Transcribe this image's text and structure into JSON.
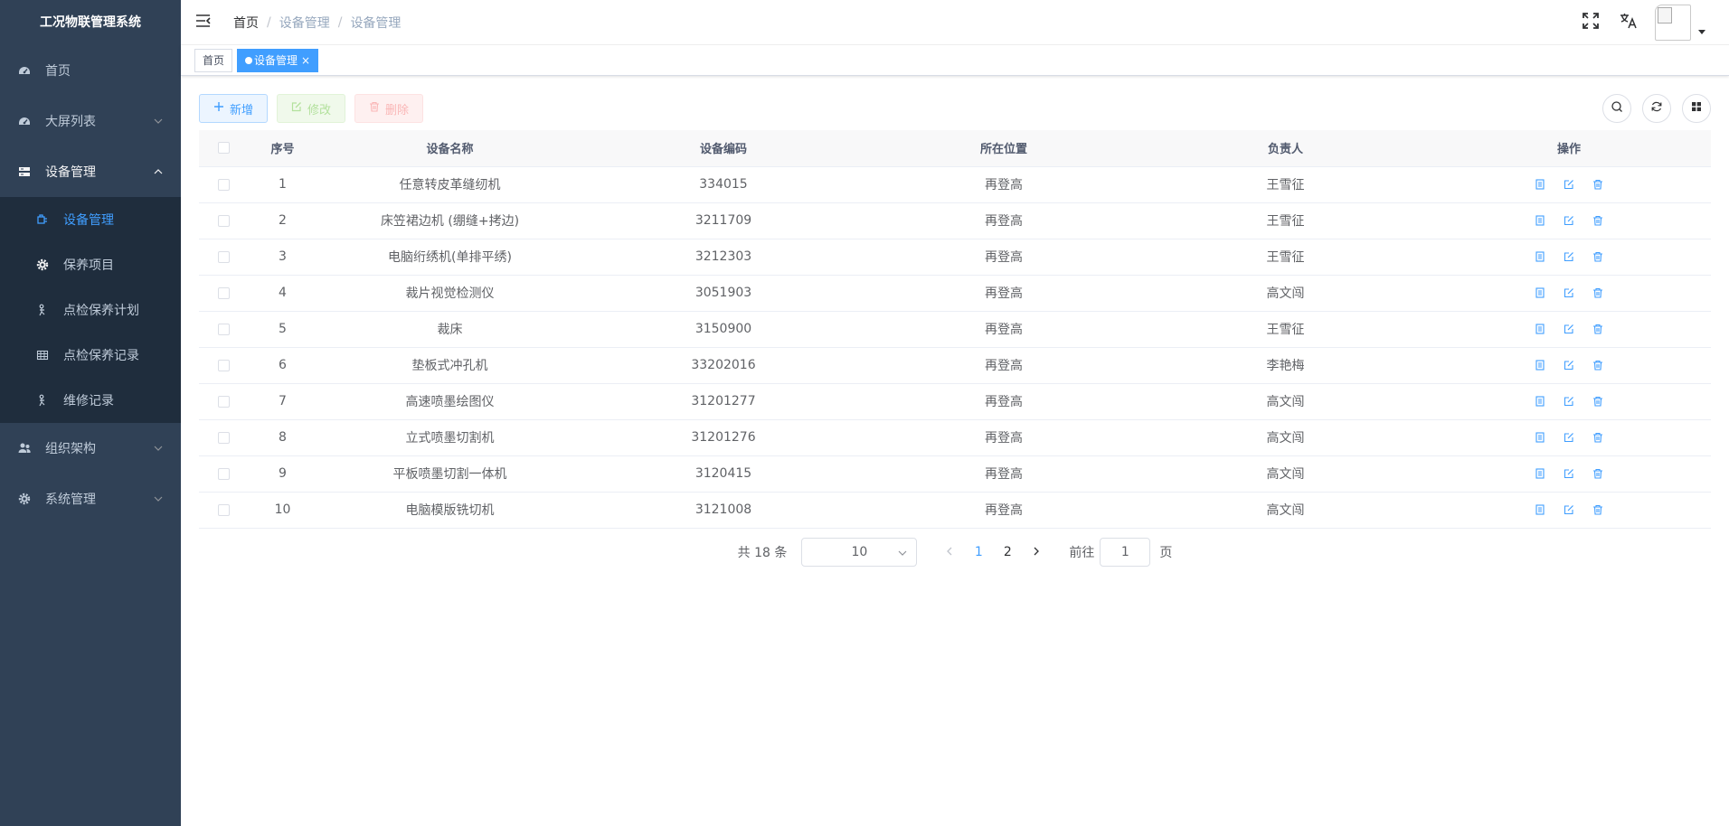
{
  "app": {
    "title": "工况物联管理系统"
  },
  "sidebar": {
    "items": [
      {
        "label": "首页"
      },
      {
        "label": "大屏列表"
      },
      {
        "label": "设备管理"
      },
      {
        "label": "组织架构"
      },
      {
        "label": "系统管理"
      }
    ],
    "submenu": [
      {
        "label": "设备管理"
      },
      {
        "label": "保养项目"
      },
      {
        "label": "点检保养计划"
      },
      {
        "label": "点检保养记录"
      },
      {
        "label": "维修记录"
      }
    ]
  },
  "breadcrumb": {
    "home": "首页",
    "level1": "设备管理",
    "level2": "设备管理",
    "sep": "/"
  },
  "tags": {
    "home": "首页",
    "active": "设备管理",
    "close": "×"
  },
  "toolbar": {
    "add": "新增",
    "edit": "修改",
    "delete": "删除"
  },
  "table": {
    "headers": {
      "index": "序号",
      "name": "设备名称",
      "code": "设备编码",
      "location": "所在位置",
      "owner": "负责人",
      "actions": "操作"
    },
    "rows": [
      {
        "index": "1",
        "name": "任意转皮革缝纫机",
        "code": "334015",
        "location": "再登高",
        "owner": "王雪征"
      },
      {
        "index": "2",
        "name": "床笠裙边机 (绷缝+拷边)",
        "code": "3211709",
        "location": "再登高",
        "owner": "王雪征"
      },
      {
        "index": "3",
        "name": "电脑绗绣机(单排平绣)",
        "code": "3212303",
        "location": "再登高",
        "owner": "王雪征"
      },
      {
        "index": "4",
        "name": "裁片视觉检测仪",
        "code": "3051903",
        "location": "再登高",
        "owner": "高文闯"
      },
      {
        "index": "5",
        "name": "裁床",
        "code": "3150900",
        "location": "再登高",
        "owner": "王雪征"
      },
      {
        "index": "6",
        "name": "垫板式冲孔机",
        "code": "33202016",
        "location": "再登高",
        "owner": "李艳梅"
      },
      {
        "index": "7",
        "name": "高速喷墨绘图仪",
        "code": "31201277",
        "location": "再登高",
        "owner": "高文闯"
      },
      {
        "index": "8",
        "name": "立式喷墨切割机",
        "code": "31201276",
        "location": "再登高",
        "owner": "高文闯"
      },
      {
        "index": "9",
        "name": "平板喷墨切割一体机",
        "code": "3120415",
        "location": "再登高",
        "owner": "高文闯"
      },
      {
        "index": "10",
        "name": "电脑模版铣切机",
        "code": "3121008",
        "location": "再登高",
        "owner": "高文闯"
      }
    ]
  },
  "pagination": {
    "total": "共 18 条",
    "page_size": "10",
    "pages": [
      "1",
      "2"
    ],
    "current": "1",
    "goto_label": "前往",
    "goto_value": "1",
    "page_unit": "页"
  },
  "colors": {
    "sidebar_bg": "#304156",
    "submenu_bg": "#1f2d3d",
    "accent": "#409eff"
  }
}
